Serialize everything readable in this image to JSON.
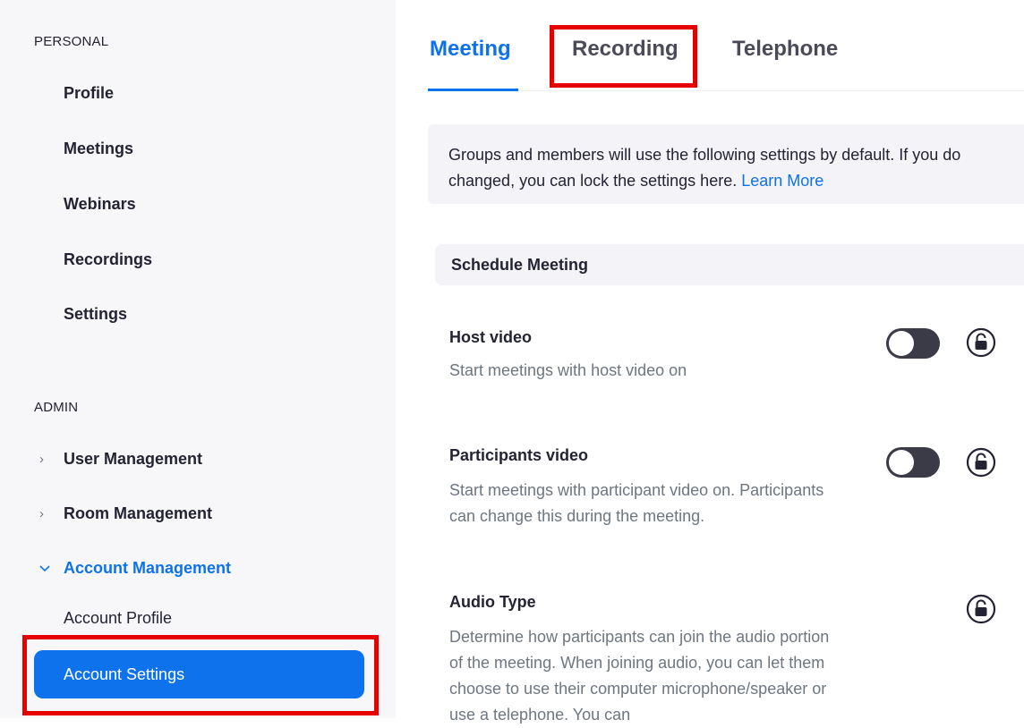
{
  "sidebar": {
    "personal_title": "PERSONAL",
    "personal_items": [
      "Profile",
      "Meetings",
      "Webinars",
      "Recordings",
      "Settings"
    ],
    "admin_title": "ADMIN",
    "admin_groups": {
      "user_management": "User Management",
      "room_management": "Room Management",
      "account_management": "Account Management"
    },
    "account_items": {
      "account_profile": "Account Profile",
      "account_settings": "Account Settings"
    }
  },
  "tabs": {
    "meeting": "Meeting",
    "recording": "Recording",
    "telephone": "Telephone"
  },
  "info": {
    "line1": "Groups and members will use the following settings by default. If you do",
    "line2": "changed, you can lock the settings here. ",
    "link": "Learn More"
  },
  "section": {
    "title": "Schedule Meeting"
  },
  "settings": [
    {
      "title": "Host video",
      "desc": "Start meetings with host video on",
      "toggle": "off"
    },
    {
      "title": "Participants video",
      "desc": "Start meetings with participant video on. Participants can change this during the meeting.",
      "toggle": "off"
    },
    {
      "title": "Audio Type",
      "desc": "Determine how participants can join the audio portion of the meeting. When joining audio, you can let them choose to use their computer microphone/speaker or use a telephone. You can"
    }
  ],
  "colors": {
    "accent": "#0e72ed",
    "highlight_box": "#e60000",
    "toggle_off": "#3b3b48"
  }
}
